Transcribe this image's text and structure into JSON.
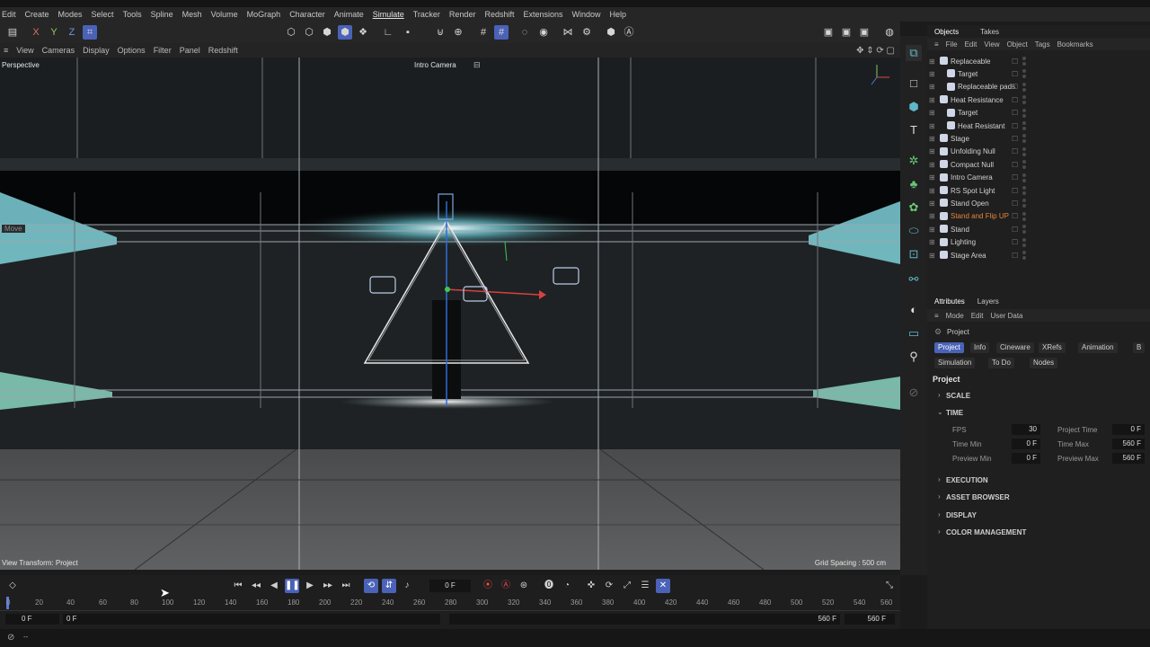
{
  "menu": {
    "items": [
      "Edit",
      "Create",
      "Modes",
      "Select",
      "Tools",
      "Spline",
      "Mesh",
      "Volume",
      "MoGraph",
      "Character",
      "Animate",
      "Simulate",
      "Tracker",
      "Render",
      "Redshift",
      "Extensions",
      "Window",
      "Help"
    ]
  },
  "axis_buttons": {
    "x": "X",
    "y": "Y",
    "z": "Z"
  },
  "viewport_menu": {
    "items": [
      "View",
      "Cameras",
      "Display",
      "Options",
      "Filter",
      "Panel",
      "Redshift"
    ]
  },
  "viewport": {
    "name": "Perspective",
    "camera": "Intro Camera",
    "hud_label": "Move",
    "view_transform": "View Transform: Project",
    "grid_spacing": "Grid Spacing : 500 cm"
  },
  "timeline": {
    "current_frame": "0 F",
    "ticks": [
      "0",
      "20",
      "40",
      "60",
      "80",
      "100",
      "120",
      "140",
      "160",
      "180",
      "200",
      "220",
      "240",
      "260",
      "280",
      "300",
      "320",
      "340",
      "360",
      "380",
      "400",
      "420",
      "440",
      "460",
      "480",
      "500",
      "520",
      "540",
      "560"
    ],
    "start_a": "0 F",
    "start_b": "0 F",
    "end_a": "560 F",
    "end_b": "560 F"
  },
  "objects_panel": {
    "tabs": [
      "Objects",
      "Takes"
    ],
    "menu": [
      "File",
      "Edit",
      "View",
      "Object",
      "Tags",
      "Bookmarks"
    ],
    "rows": [
      {
        "name": "Replaceable",
        "indent": 0,
        "color": "#d0d0d0"
      },
      {
        "name": "Target",
        "indent": 1,
        "color": "#d0d0d0"
      },
      {
        "name": "Replaceable pads",
        "indent": 1,
        "color": "#d0d0d0"
      },
      {
        "name": "Heat Resistance",
        "indent": 0,
        "color": "#d0d0d0"
      },
      {
        "name": "Target",
        "indent": 1,
        "color": "#d0d0d0"
      },
      {
        "name": "Heat Resistant",
        "indent": 1,
        "color": "#d0d0d0"
      },
      {
        "name": "Stage",
        "indent": 0,
        "color": "#d0d0d0"
      },
      {
        "name": "Unfolding Null",
        "indent": 0,
        "color": "#d0d0d0"
      },
      {
        "name": "Compact Null",
        "indent": 0,
        "color": "#d0d0d0"
      },
      {
        "name": "Intro Camera",
        "indent": 0,
        "color": "#d0d0d0"
      },
      {
        "name": "RS Spot Light",
        "indent": 0,
        "color": "#d0d0d0"
      },
      {
        "name": "Stand Open",
        "indent": 0,
        "color": "#d0d0d0"
      },
      {
        "name": "Stand and Flip UP",
        "indent": 0,
        "color": "#e5833a"
      },
      {
        "name": "Stand",
        "indent": 0,
        "color": "#d0d0d0"
      },
      {
        "name": "Lighting",
        "indent": 0,
        "color": "#d0d0d0"
      },
      {
        "name": "Stage Area",
        "indent": 0,
        "color": "#d0d0d0"
      }
    ]
  },
  "attributes_panel": {
    "tabs": [
      "Attributes",
      "Layers"
    ],
    "menu": [
      "Mode",
      "Edit",
      "User Data"
    ],
    "object_label": "Project",
    "chips_row1": [
      "Project",
      "Info",
      "Cineware",
      "XRefs",
      "Animation",
      "B"
    ],
    "chips_row2": [
      "Simulation",
      "To Do",
      "Nodes"
    ],
    "heading": "Project",
    "sections": {
      "scale": "SCALE",
      "time": "TIME",
      "execution": "EXECUTION",
      "asset_browser": "ASSET BROWSER",
      "display": "DISPLAY",
      "color_management": "COLOR MANAGEMENT"
    },
    "fields": {
      "fps_label": "FPS",
      "fps": "30",
      "project_time_label": "Project Time",
      "project_time": "0 F",
      "time_min_label": "Time Min",
      "time_min": "0 F",
      "time_max_label": "Time Max",
      "time_max": "560 F",
      "preview_min_label": "Preview Min",
      "preview_min": "0 F",
      "preview_max_label": "Preview Max",
      "preview_max": "560 F"
    }
  },
  "status": {
    "text": "--"
  }
}
